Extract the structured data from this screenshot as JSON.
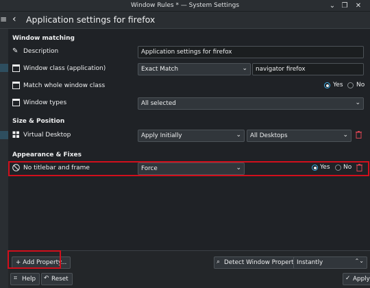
{
  "window": {
    "title": "Window Rules * — System Settings",
    "minimize_glyph": "⌄",
    "maximize_glyph": "❐",
    "close_glyph": "✕"
  },
  "header": {
    "menu_glyph": "≡",
    "back_glyph": "‹",
    "title": "Application settings for firefox"
  },
  "sections": {
    "window_matching": "Window matching",
    "size_position": "Size & Position",
    "appearance_fixes": "Appearance & Fixes"
  },
  "rows": {
    "description": {
      "label": "Description",
      "icon": "pencil-icon",
      "value": "Application settings for firefox"
    },
    "window_class": {
      "label": "Window class (application)",
      "icon": "window-icon",
      "match": "Exact Match",
      "value": "navigator firefox"
    },
    "match_whole": {
      "label": "Match whole window class",
      "icon": "window-icon",
      "yes": "Yes",
      "no": "No",
      "selected": "Yes"
    },
    "window_types": {
      "label": "Window types",
      "icon": "window-icon",
      "value": "All selected"
    },
    "virtual_desktop": {
      "label": "Virtual Desktop",
      "icon": "virtual-desktop-icon",
      "policy": "Apply Initially",
      "value": "All Desktops"
    },
    "no_titlebar": {
      "label": "No titlebar and frame",
      "icon": "no-titlebar-icon",
      "policy": "Force",
      "yes": "Yes",
      "no": "No",
      "selected": "Yes"
    }
  },
  "footer": {
    "add_property": "+ Add Property...",
    "detect": "Detect Window Properties",
    "detect_delay": "Instantly",
    "help": "Help",
    "reset": "Reset",
    "apply": "Apply"
  },
  "colors": {
    "accent": "#3daee9",
    "highlight_box": "#d20f1c",
    "trash": "#da4453"
  }
}
